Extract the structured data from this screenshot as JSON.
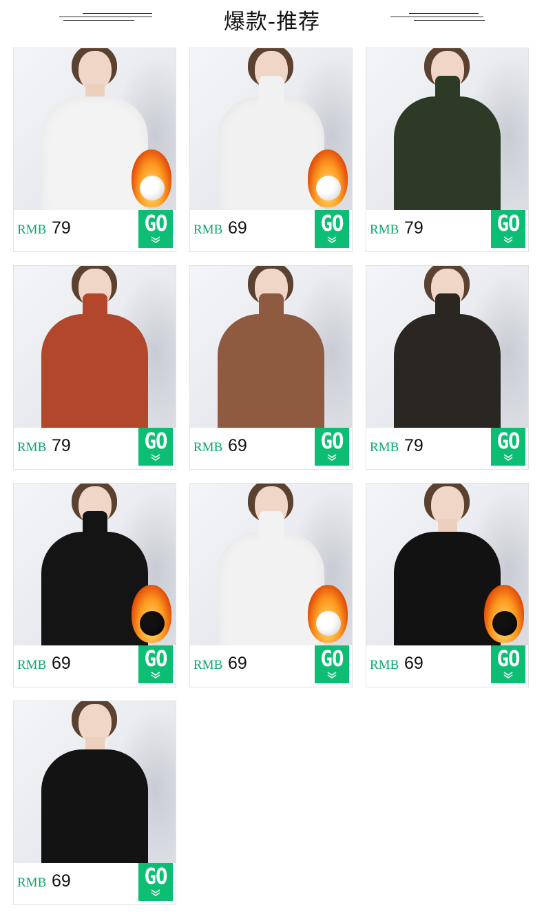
{
  "header": {
    "title": "爆款-推荐"
  },
  "colors": {
    "accent": "#0cbd74",
    "currency": "#0aa86a"
  },
  "products": [
    {
      "currency": "RMB",
      "price": "79",
      "go_label": "GO",
      "chevron": "double-chevron-down-icon",
      "garment_color": "#f3f3f3",
      "collar": "round-neck",
      "fleece_badge": true,
      "fleece_color": "#ffffff"
    },
    {
      "currency": "RMB",
      "price": "69",
      "go_label": "GO",
      "chevron": "double-chevron-down-icon",
      "garment_color": "#f1f1f1",
      "collar": "turtleneck",
      "fleece_badge": true,
      "fleece_color": "#ffffff"
    },
    {
      "currency": "RMB",
      "price": "79",
      "go_label": "GO",
      "chevron": "double-chevron-down-icon",
      "garment_color": "#2d3a26",
      "collar": "ruffle",
      "fleece_badge": false
    },
    {
      "currency": "RMB",
      "price": "79",
      "go_label": "GO",
      "chevron": "double-chevron-down-icon",
      "garment_color": "#b2472b",
      "collar": "ruffle",
      "fleece_badge": false
    },
    {
      "currency": "RMB",
      "price": "69",
      "go_label": "GO",
      "chevron": "double-chevron-down-icon",
      "garment_color": "#8e5a40",
      "collar": "ruffle",
      "fleece_badge": false
    },
    {
      "currency": "RMB",
      "price": "79",
      "go_label": "GO",
      "chevron": "double-chevron-down-icon",
      "garment_color": "#2a2622",
      "collar": "ruffle",
      "fleece_badge": false
    },
    {
      "currency": "RMB",
      "price": "69",
      "go_label": "GO",
      "chevron": "double-chevron-down-icon",
      "garment_color": "#141414",
      "collar": "turtleneck",
      "fleece_badge": true,
      "fleece_color": "#111111"
    },
    {
      "currency": "RMB",
      "price": "69",
      "go_label": "GO",
      "chevron": "double-chevron-down-icon",
      "garment_color": "#f2f2f2",
      "collar": "turtleneck",
      "fleece_badge": true,
      "fleece_color": "#ffffff"
    },
    {
      "currency": "RMB",
      "price": "69",
      "go_label": "GO",
      "chevron": "double-chevron-down-icon",
      "garment_color": "#121212",
      "collar": "round-neck",
      "fleece_badge": true,
      "fleece_color": "#111111"
    },
    {
      "currency": "RMB",
      "price": "69",
      "go_label": "GO",
      "chevron": "double-chevron-down-icon",
      "garment_color": "#131313",
      "collar": "round-neck",
      "fleece_badge": false
    }
  ]
}
